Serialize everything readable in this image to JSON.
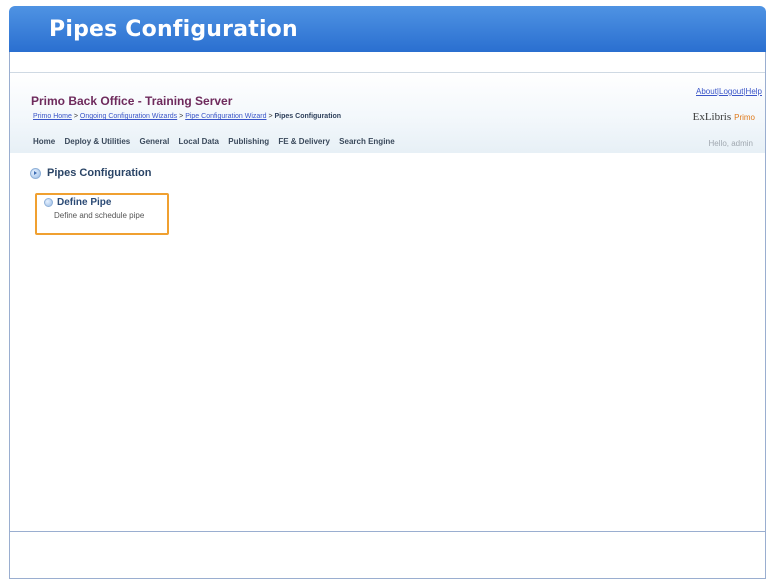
{
  "slide": {
    "title": "Pipes Configuration"
  },
  "app": {
    "top_links": [
      "About",
      "Logout",
      "Help"
    ],
    "title": "Primo Back Office - Training Server",
    "breadcrumb": {
      "links": [
        "Primo Home",
        "Ongoing Configuration Wizards",
        "Pipe Configuration Wizard"
      ],
      "separator": ">",
      "current": "Pipes Configuration"
    },
    "logo": {
      "text": "ExLibris",
      "product": "Primo"
    },
    "nav": [
      "Home",
      "Deploy & Utilities",
      "General",
      "Local Data",
      "Publishing",
      "FE & Delivery",
      "Search Engine"
    ],
    "greeting": "Hello, admin"
  },
  "content": {
    "section_title": "Pipes Configuration",
    "item": {
      "title": "Define Pipe",
      "description": "Define and schedule pipe"
    }
  },
  "colors": {
    "banner": "#2a6fd0",
    "highlight": "#f0a030",
    "app_title": "#6e2a5c"
  }
}
